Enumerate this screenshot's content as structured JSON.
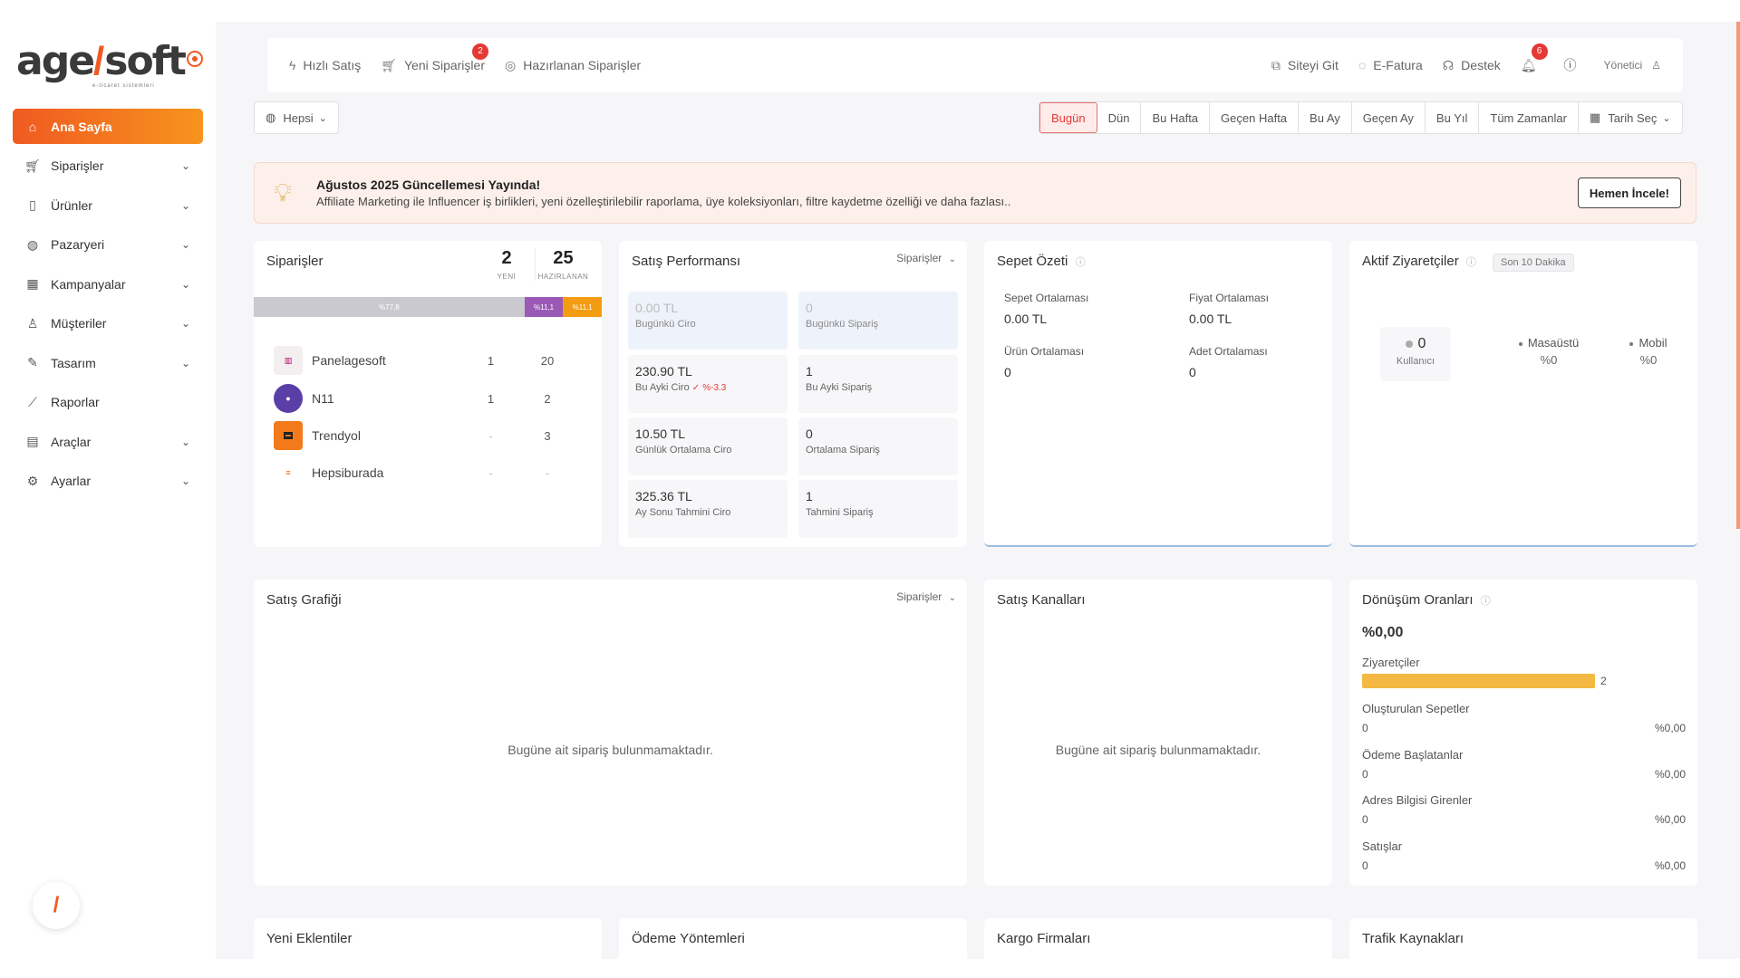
{
  "brand": {
    "logo_part1": "age",
    "logo_slash": "/",
    "logo_part2": "soft",
    "logo_tagline": "e-ticaret sistemleri"
  },
  "sidebar": {
    "items": [
      {
        "label": "Ana Sayfa",
        "icon": "home-icon",
        "active": true,
        "expandable": false
      },
      {
        "label": "Siparişler",
        "icon": "cart-icon",
        "expandable": true
      },
      {
        "label": "Ürünler",
        "icon": "book-icon",
        "expandable": true
      },
      {
        "label": "Pazaryeri",
        "icon": "globe-icon",
        "expandable": true
      },
      {
        "label": "Kampanyalar",
        "icon": "calendar-icon",
        "expandable": true
      },
      {
        "label": "Müşteriler",
        "icon": "user-icon",
        "expandable": true
      },
      {
        "label": "Tasarım",
        "icon": "edit-icon",
        "expandable": true
      },
      {
        "label": "Raporlar",
        "icon": "chart-icon",
        "expandable": false
      },
      {
        "label": "Araçlar",
        "icon": "clipboard-icon",
        "expandable": true
      },
      {
        "label": "Ayarlar",
        "icon": "gear-icon",
        "expandable": true
      }
    ]
  },
  "topbar": {
    "quick_sale": "Hızlı Satış",
    "new_orders": "Yeni Siparişler",
    "new_orders_badge": "2",
    "prepared_orders": "Hazırlanan Siparişler",
    "go_site": "Siteyi Git",
    "e_invoice": "E-Fatura",
    "support": "Destek",
    "notif_badge": "6",
    "user": "Yönetici"
  },
  "filters": {
    "scope": "Hepsi",
    "dates": [
      "Bugün",
      "Dün",
      "Bu Hafta",
      "Geçen Hafta",
      "Bu Ay",
      "Geçen Ay",
      "Bu Yıl",
      "Tüm Zamanlar"
    ],
    "active_date": "Bugün",
    "pick_date": "Tarih Seç"
  },
  "announcement": {
    "title": "Ağustos 2025 Güncellemesi Yayında!",
    "text": "Affiliate Marketing ile Influencer iş birlikleri, yeni özelleştirilebilir raporlama, üye koleksiyonları, filtre kaydetme özelliği ve daha fazlası..",
    "button": "Hemen İncele!"
  },
  "orders_card": {
    "title": "Siparişler",
    "new_count": "2",
    "new_label": "YENİ",
    "prepared_count": "25",
    "prepared_label": "HAZIRLANAN",
    "progress": [
      {
        "label": "%77,8",
        "value": 77.8,
        "color": "#c9c9cf"
      },
      {
        "label": "%11,1",
        "value": 11.1,
        "color": "#9b59b6"
      },
      {
        "label": "%11,1",
        "value": 11.1,
        "color": "#f39c12"
      }
    ],
    "rows": [
      {
        "name": "Panelagesoft",
        "new": "1",
        "prepared": "20",
        "logo": "panelagesoft-logo"
      },
      {
        "name": "N11",
        "new": "1",
        "prepared": "2",
        "logo": "n11-logo"
      },
      {
        "name": "Trendyol",
        "new": "-",
        "prepared": "3",
        "logo": "trendyol-logo"
      },
      {
        "name": "Hepsiburada",
        "new": "-",
        "prepared": "-",
        "logo": "hepsiburada-logo"
      }
    ]
  },
  "sales_perf": {
    "title": "Satış Performansı",
    "dropdown": "Siparişler",
    "boxes": [
      {
        "value": "0.00 TL",
        "label": "Bugünkü Ciro"
      },
      {
        "value": "0",
        "label": "Bugünkü Sipariş"
      },
      {
        "value": "230.90 TL",
        "label": "Bu Ayki Ciro",
        "change": "%-3.3"
      },
      {
        "value": "1",
        "label": "Bu Ayki Sipariş"
      },
      {
        "value": "10.50 TL",
        "label": "Günlük Ortalama Ciro"
      },
      {
        "value": "0",
        "label": "Ortalama Sipariş"
      },
      {
        "value": "325.36 TL",
        "label": "Ay Sonu Tahmini Ciro"
      },
      {
        "value": "1",
        "label": "Tahmini Sipariş"
      }
    ]
  },
  "basket": {
    "title": "Sepet Özeti",
    "items": [
      {
        "label": "Sepet Ortalaması",
        "value": "0.00 TL"
      },
      {
        "label": "Fiyat Ortalaması",
        "value": "0.00 TL"
      },
      {
        "label": "Ürün Ortalaması",
        "value": "0"
      },
      {
        "label": "Adet Ortalaması",
        "value": "0"
      }
    ]
  },
  "visitors": {
    "title": "Aktif Ziyaretçiler",
    "range": "Son 10 Dakika",
    "online": "0",
    "online_label": "Kullanıcı",
    "desktop_label": "Masaüstü",
    "desktop_value": "%0",
    "mobile_label": "Mobil",
    "mobile_value": "%0"
  },
  "sales_chart": {
    "title": "Satış Grafiği",
    "dropdown": "Siparişler",
    "empty": "Bugüne ait sipariş bulunmamaktadır."
  },
  "sales_channels": {
    "title": "Satış Kanalları",
    "empty": "Bugüne ait sipariş bulunmamaktadır."
  },
  "conversion": {
    "title": "Dönüşüm Oranları",
    "rate": "%0,00",
    "visitors_label": "Ziyaretçiler",
    "visitors_value": "2",
    "rows": [
      {
        "label": "Oluşturulan Sepetler",
        "count": "0",
        "pct": "%0,00"
      },
      {
        "label": "Ödeme Başlatanlar",
        "count": "0",
        "pct": "%0,00"
      },
      {
        "label": "Adres Bilgisi Girenler",
        "count": "0",
        "pct": "%0,00"
      },
      {
        "label": "Satışlar",
        "count": "0",
        "pct": "%0,00"
      }
    ]
  },
  "bottom_cards": [
    "Yeni Eklentiler",
    "Ödeme Yöntemleri",
    "Kargo Firmaları",
    "Trafik Kaynakları"
  ]
}
